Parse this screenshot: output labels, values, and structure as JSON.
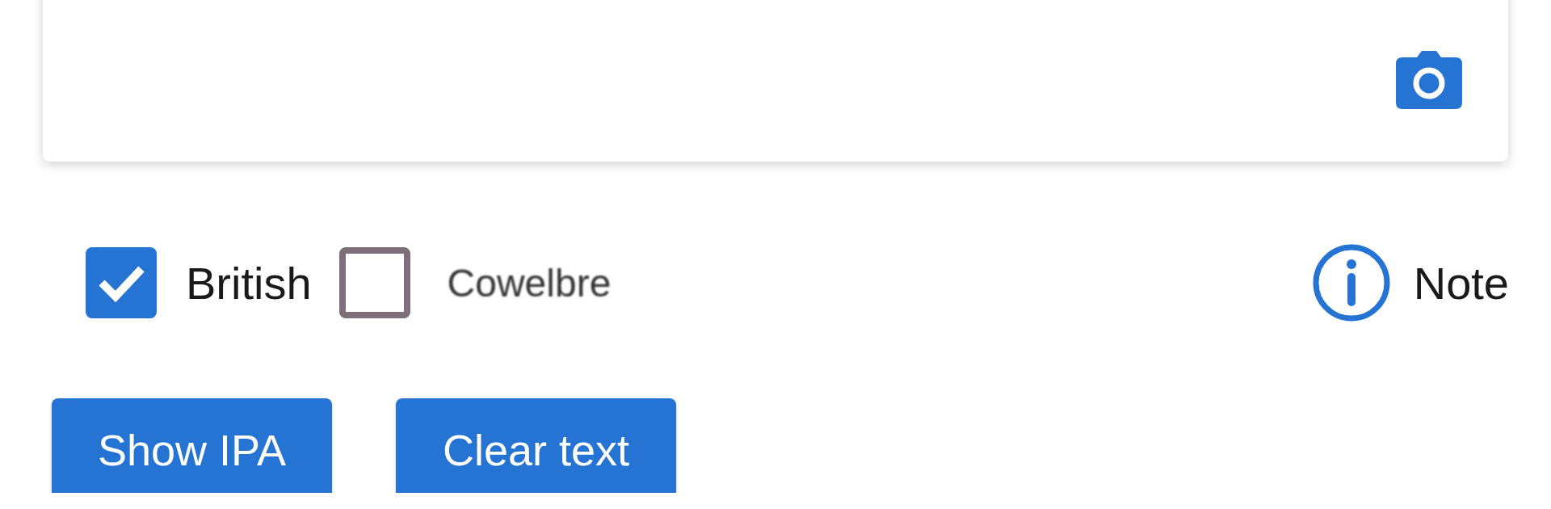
{
  "options": [
    {
      "label": "British",
      "checked": true
    },
    {
      "label": "Cowelbre",
      "checked": false
    }
  ],
  "note": {
    "label": "Note"
  },
  "buttons": [
    "Show IPA",
    "Clear text"
  ]
}
